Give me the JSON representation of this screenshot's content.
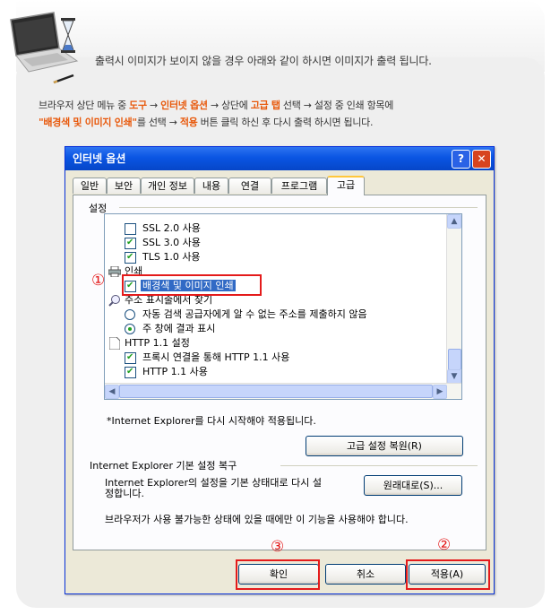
{
  "header": {
    "headline": "출력시 이미지가 보이지 않을 경우 아래와 같이 하시면 이미지가 출력 됩니다.",
    "instruction_line1": {
      "p1": "브라우저 상단 메뉴 중 ",
      "menu_tools": "도구",
      "arrow1": " → ",
      "internet_options": "인터넷 옵션",
      "p2": " → 상단에 ",
      "advanced_tab": "고급 탭",
      "p3": " 선택 → 설정 중 인쇄 항목에"
    },
    "instruction_line2": {
      "quoted_item": "\"배경색 및 이미지 인쇄\"",
      "p1": "를 선택 → ",
      "apply": "적용",
      "p2": " 버튼 클릭 하신 후 다시 출력 하시면 됩니다."
    }
  },
  "dialog": {
    "title": "인터넷 옵션",
    "help_glyph": "?",
    "close_glyph": "✕",
    "tabs": [
      "일반",
      "보안",
      "개인 정보",
      "내용",
      "연결",
      "프로그램",
      "고급"
    ],
    "settings_label": "설정",
    "list_rows": [
      {
        "label": "SSL 2.0 사용",
        "control": "checkbox",
        "checked": false
      },
      {
        "label": "SSL 3.0 사용",
        "control": "checkbox",
        "checked": true
      },
      {
        "label": "TLS 1.0 사용",
        "control": "checkbox",
        "checked": true
      },
      {
        "label": "인쇄",
        "control": "category-print"
      },
      {
        "label": "배경색 및 이미지 인쇄",
        "control": "checkbox",
        "checked": true
      },
      {
        "label": "주소 표시줄에서 찾기",
        "control": "category-search"
      },
      {
        "label": "자동 검색 공급자에게 알 수 없는 주소를 제출하지 않음",
        "control": "radio",
        "checked": false
      },
      {
        "label": "주 창에 결과 표시",
        "control": "radio",
        "checked": true
      },
      {
        "label": "HTTP 1.1 설정",
        "control": "category-page"
      },
      {
        "label": "프록시 연결을 통해 HTTP 1.1 사용",
        "control": "checkbox",
        "checked": true
      },
      {
        "label": "HTTP 1.1 사용",
        "control": "checkbox",
        "checked": true
      }
    ],
    "restart_note": "*Internet Explorer를 다시 시작해야 적용됩니다.",
    "restore_advanced_button": "고급 설정 복원(R)",
    "reset_group_label": "Internet Explorer 기본 설정 복구",
    "reset_desc_line1": "Internet Explorer의 설정을 기본 상태대로 다시 설",
    "reset_desc_line2": "정합니다.",
    "reset_button": "원래대로(S)...",
    "unusable_note": "브라우저가 사용 불가능한 상태에 있을 때에만 이 기능을 사용해야 합니다.",
    "ok_button": "확인",
    "cancel_button": "취소",
    "apply_button": "적용(A)"
  },
  "callouts": {
    "step1": "①",
    "step2": "②",
    "step3": "③"
  },
  "colors": {
    "accent": "#e8590c",
    "callout_red": "#e41b1b",
    "titlebar_blue": "#0a55e3",
    "check_green": "#21a121"
  }
}
